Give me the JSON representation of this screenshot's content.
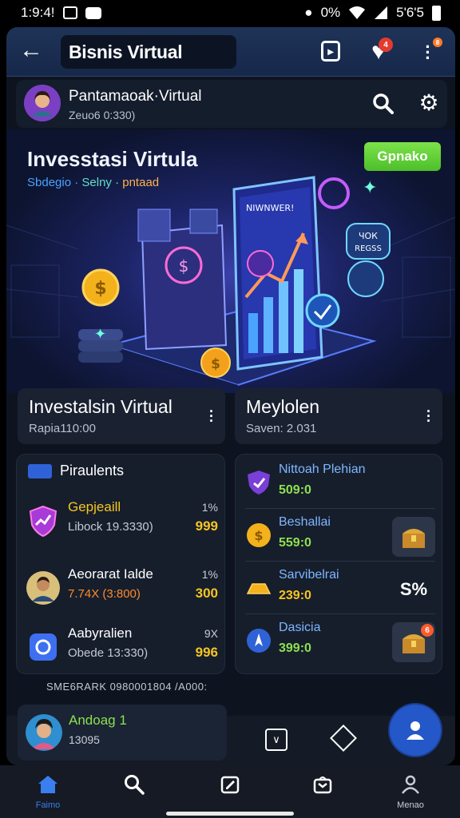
{
  "status_bar": {
    "time": "1:9:4!",
    "network": "0%",
    "battery": "5'6'5"
  },
  "app_bar": {
    "title": "Bisnis Virtual",
    "heart_badge": "4",
    "more_badge": "8"
  },
  "profile": {
    "name": "Pantamaoak·Virtual",
    "sub": "Zeuo6 0:330)"
  },
  "hero": {
    "title": "Invesstasi Virtula",
    "sub1": "Sbdegio ·",
    "sub2": "Selny ·",
    "sub3": "pntaad",
    "button": "Gpnako",
    "phone_label": "NIWNWER!",
    "bubble_top": "ЧОК",
    "bubble_bottom": "REGSS"
  },
  "card_left": {
    "title": "Investalsin Virtual",
    "sub": "Rapia110:00"
  },
  "card_right": {
    "title": "Meylolen",
    "sub": "Saven: 2.031"
  },
  "left_panel": {
    "header": "Piraulents",
    "rows": [
      {
        "title": "Gepjeaill",
        "sub": "Libock 19.3330)",
        "pct": "1%",
        "value": "999"
      },
      {
        "title": "Aeorarat Ialde",
        "sub": "7.74X (3:800)",
        "pct": "1%",
        "value": "300"
      },
      {
        "title": "Aabyralien",
        "sub": "Obede 13:330)",
        "pct": "9X",
        "value": "996"
      }
    ]
  },
  "right_panel": {
    "rows": [
      {
        "title": "Nittoah Plehian",
        "value": "509:0"
      },
      {
        "title": "Beshallai",
        "value": "559:0"
      },
      {
        "title": "Sarvibelrai",
        "value": "239:0",
        "side": "S%"
      },
      {
        "title": "Dasicia",
        "value": "399:0"
      }
    ]
  },
  "footnote": "SME6RARK 0980001804 /A000:",
  "mini_card": {
    "title": "Andoag 1",
    "sub": "13095"
  },
  "bottom_nav": [
    {
      "label": "Faimo"
    },
    {
      "label": ""
    },
    {
      "label": ""
    },
    {
      "label": ""
    },
    {
      "label": "Menao"
    }
  ],
  "colors": {
    "accent": "#2457c8",
    "positive": "#8ee04e",
    "gold": "#f7c520",
    "link": "#7fb7ff"
  }
}
